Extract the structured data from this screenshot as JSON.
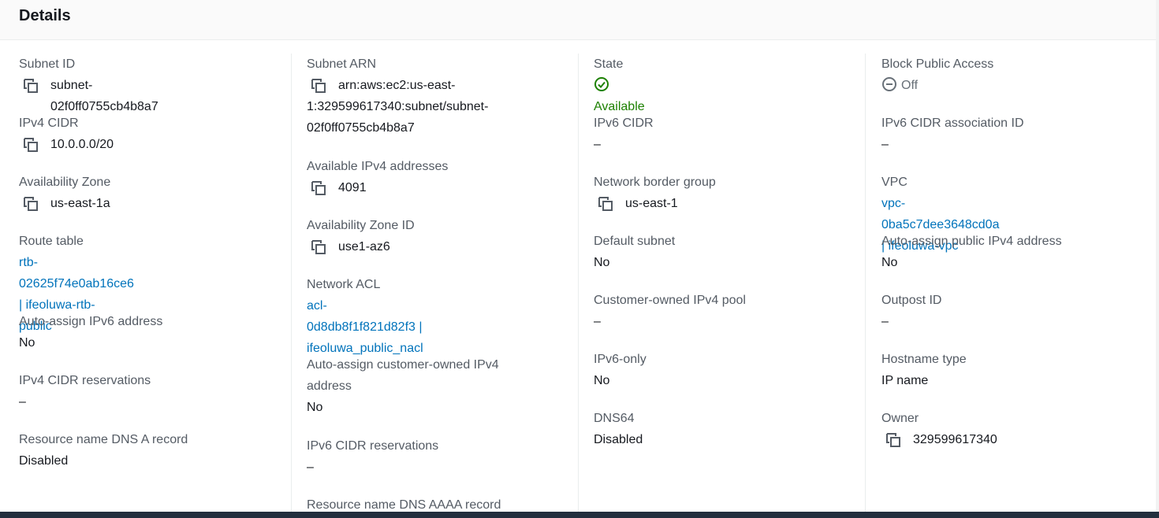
{
  "header": {
    "title": "Details"
  },
  "columns": [
    {
      "fields": [
        {
          "label": "Subnet ID",
          "value": "subnet-02f0ff0755cb4b8a7"
        },
        {
          "label": "IPv4 CIDR",
          "value": "10.0.0.0/20"
        },
        {
          "label": "Availability Zone",
          "value": "us-east-1a"
        },
        {
          "label": "Route table",
          "value_line1": "rtb-02625f74e0ab16ce6 | ifeoluwa-rtb-",
          "value_line2": "public"
        },
        {
          "label": "Auto-assign IPv6 address",
          "value": "No"
        },
        {
          "label": "IPv4 CIDR reservations",
          "value": "–"
        },
        {
          "label": "Resource name DNS A record",
          "value": "Disabled"
        }
      ]
    },
    {
      "fields": [
        {
          "label": "Subnet ARN",
          "value_line1": "arn:aws:ec2:us-east-",
          "value_line2": "1:329599617340:subnet/subnet-",
          "value_line3": "02f0ff0755cb4b8a7"
        },
        {
          "label": "Available IPv4 addresses",
          "value": "4091"
        },
        {
          "label": "Availability Zone ID",
          "value": "use1-az6"
        },
        {
          "label": "Network ACL",
          "value_line1": "acl-0d8db8f1f821d82f3 |",
          "value_line2": "ifeoluwa_public_nacl"
        },
        {
          "label_line1": "Auto-assign customer-owned IPv4",
          "label_line2": "address",
          "value": "No"
        },
        {
          "label": "IPv6 CIDR reservations",
          "value": "–"
        },
        {
          "label": "Resource name DNS AAAA record"
        }
      ]
    },
    {
      "fields": [
        {
          "label": "State",
          "value": "Available"
        },
        {
          "label": "IPv6 CIDR",
          "value": "–"
        },
        {
          "label": "Network border group",
          "value": "us-east-1"
        },
        {
          "label": "Default subnet",
          "value": "No"
        },
        {
          "label": "Customer-owned IPv4 pool",
          "value": "–"
        },
        {
          "label": "IPv6-only",
          "value": "No"
        },
        {
          "label": "DNS64",
          "value": "Disabled"
        }
      ]
    },
    {
      "fields": [
        {
          "label": "Block Public Access",
          "value": "Off"
        },
        {
          "label": "IPv6 CIDR association ID",
          "value": "–"
        },
        {
          "label": "VPC",
          "value": "vpc-0ba5c7dee3648cd0a | ifeoluwa-vpc"
        },
        {
          "label": "Auto-assign public IPv4 address",
          "value": "No"
        },
        {
          "label": "Outpost ID",
          "value": "–"
        },
        {
          "label": "Hostname type",
          "value": "IP name"
        },
        {
          "label": "Owner",
          "value": "329599617340"
        }
      ]
    }
  ],
  "icons": {
    "copy": "copy-icon",
    "available": "status-check-icon",
    "off": "status-off-icon"
  },
  "colors": {
    "link": "#0073bb",
    "success": "#1d8102",
    "muted": "#687078"
  }
}
